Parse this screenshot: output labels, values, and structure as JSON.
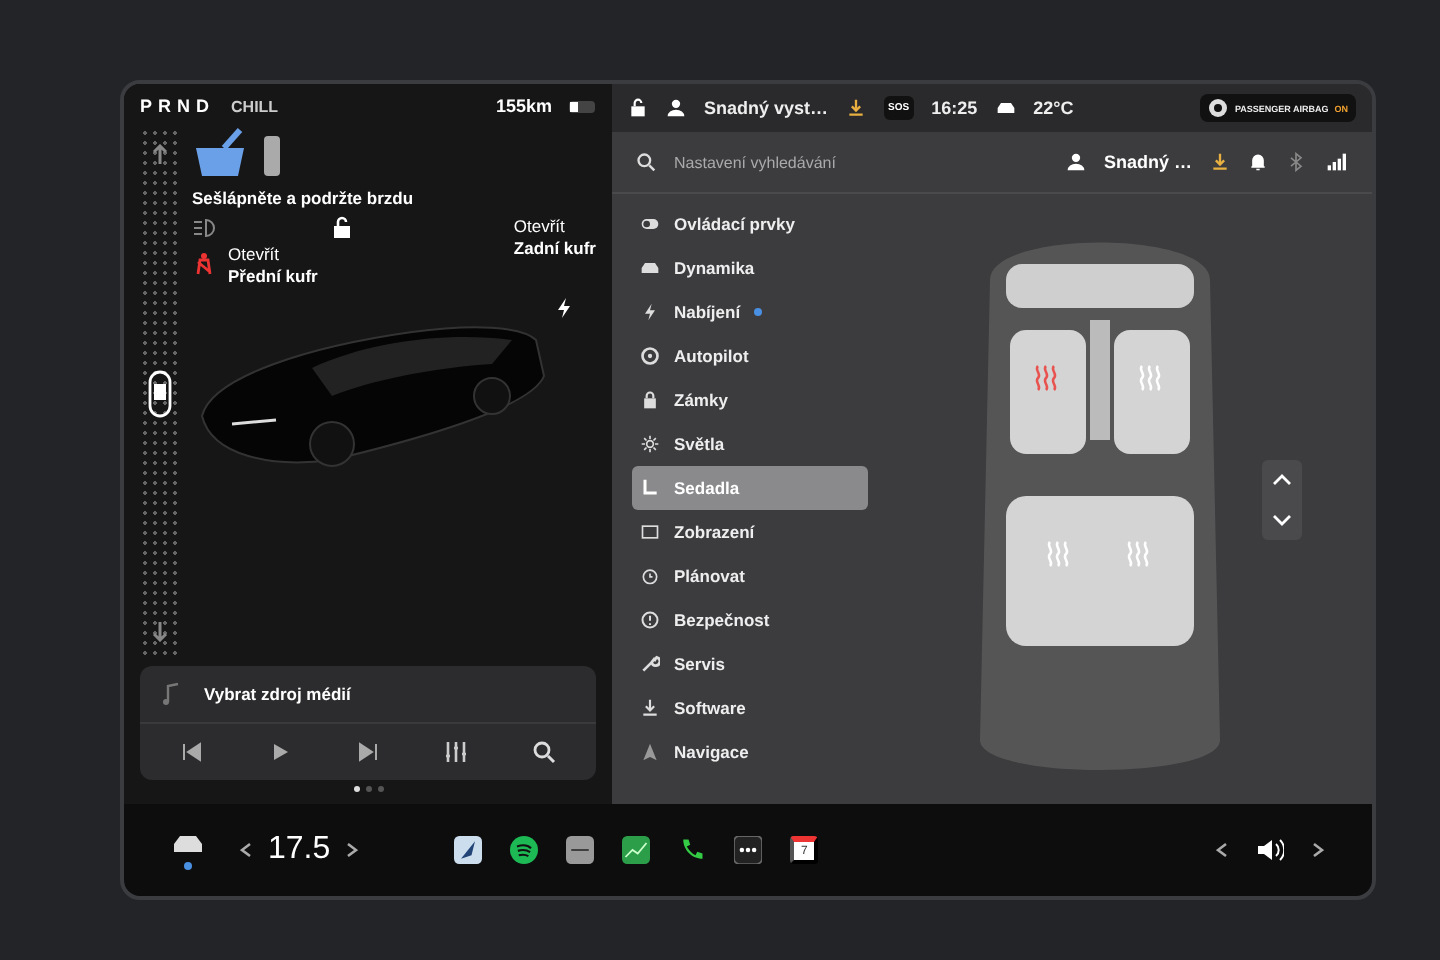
{
  "left_panel": {
    "gear_selector": "PRND",
    "drive_mode": "CHILL",
    "range": "155km",
    "brake_prompt": "Sešlápněte a podržte brzdu",
    "seatbelt_warning": true,
    "front_trunk": {
      "action": "Otevřít",
      "name": "Přední kufr"
    },
    "rear_trunk": {
      "action": "Otevřít",
      "name": "Zadní kufr"
    },
    "media": {
      "source_prompt": "Vybrat zdroj médií"
    },
    "pages": [
      {
        "selected": true
      },
      {
        "selected": false
      },
      {
        "selected": false
      }
    ]
  },
  "status_bar": {
    "profile": "Snadný vyst…",
    "sos": "SOS",
    "time": "16:25",
    "temperature": "22°C",
    "airbag_label": "PASSENGER AIRBAG",
    "airbag_state": "ON"
  },
  "search": {
    "placeholder": "Nastavení vyhledávání",
    "profile": "Snadný …"
  },
  "settings_menu": [
    {
      "label": "Ovládací prvky",
      "selected": false,
      "notification": false
    },
    {
      "label": "Dynamika",
      "selected": false,
      "notification": false
    },
    {
      "label": "Nabíjení",
      "selected": false,
      "notification": true
    },
    {
      "label": "Autopilot",
      "selected": false,
      "notification": false
    },
    {
      "label": "Zámky",
      "selected": false,
      "notification": false
    },
    {
      "label": "Světla",
      "selected": false,
      "notification": false
    },
    {
      "label": "Sedadla",
      "selected": true,
      "notification": false
    },
    {
      "label": "Zobrazení",
      "selected": false,
      "notification": false
    },
    {
      "label": "Plánovat",
      "selected": false,
      "notification": false
    },
    {
      "label": "Bezpečnost",
      "selected": false,
      "notification": false
    },
    {
      "label": "Servis",
      "selected": false,
      "notification": false
    },
    {
      "label": "Software",
      "selected": false,
      "notification": false
    },
    {
      "label": "Navigace",
      "selected": false,
      "notification": false
    }
  ],
  "seats": [
    {
      "heated": true
    },
    {
      "heated": false
    },
    {
      "heated": false
    },
    {
      "heated": false
    }
  ],
  "dock": {
    "temperature": "17.5",
    "calendar_day": "7"
  }
}
